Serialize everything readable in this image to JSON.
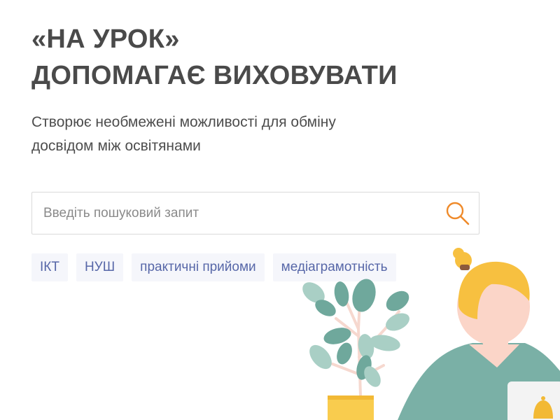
{
  "hero": {
    "title_line1": "«НА УРОК»",
    "title_line2": "ДОПОМАГАЄ ВИХОВУВАТИ",
    "subtitle_line1": "Створює необмежені можливості для обміну",
    "subtitle_line2": "досвідом між освітянами"
  },
  "search": {
    "placeholder": "Введіть пошуковий запит",
    "value": "",
    "icon": "search-icon"
  },
  "tags": [
    {
      "label": "ІКТ"
    },
    {
      "label": "НУШ"
    },
    {
      "label": "практичні прийоми"
    },
    {
      "label": "медіаграмотність"
    }
  ],
  "colors": {
    "title": "#4a4a4a",
    "tag_text": "#5767a8",
    "tag_bg": "#f5f6fb",
    "accent_orange": "#ef8a2a",
    "leaf_green": "#6fa89c",
    "hair_yellow": "#f7c040",
    "shirt_teal": "#7ab0a6",
    "pot_yellow": "#f9cc4e"
  }
}
